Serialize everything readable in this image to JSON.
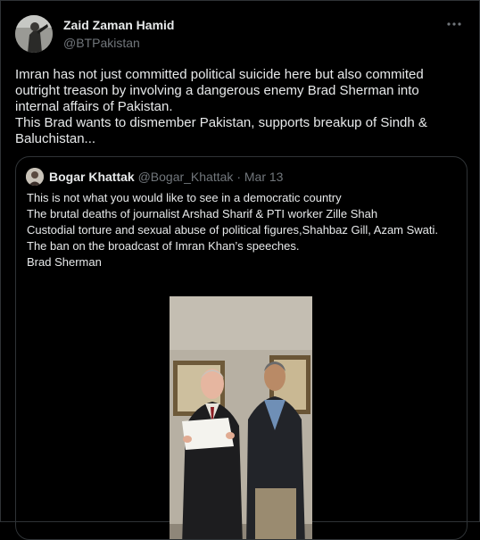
{
  "tweet": {
    "author_name": "Zaid Zaman Hamid",
    "author_handle": "@BTPakistan",
    "text_lines": [
      "Imran has not just committed political suicide here but also commited outright treason by involving a dangerous enemy Brad Sherman into internal affairs of Pakistan.",
      "This Brad wants to dismember Pakistan, supports breakup of Sindh & Baluchistan..."
    ],
    "avatar_icon": "profile-photo",
    "more_icon": "more-horizontal-icon"
  },
  "quoted_tweet": {
    "author_name": "Bogar Khattak",
    "author_handle": "@Bogar_Khattak",
    "separator": "·",
    "date": "Mar 13",
    "text_lines": [
      "This is not what you would like to see in a democratic country",
      "The brutal deaths of journalist Arshad Sharif & PTI worker Zille Shah",
      "Custodial torture and sexual abuse of political figures,Shahbaz Gill,  Azam Swati.",
      "The ban on the broadcast of  Imran Khan’s speeches.",
      "Brad Sherman"
    ],
    "avatar_icon": "profile-photo",
    "media": "video-thumbnail"
  },
  "colors": {
    "background": "#000000",
    "text_primary": "#e7e9ea",
    "text_secondary": "#71767b",
    "border": "#2f3336"
  }
}
